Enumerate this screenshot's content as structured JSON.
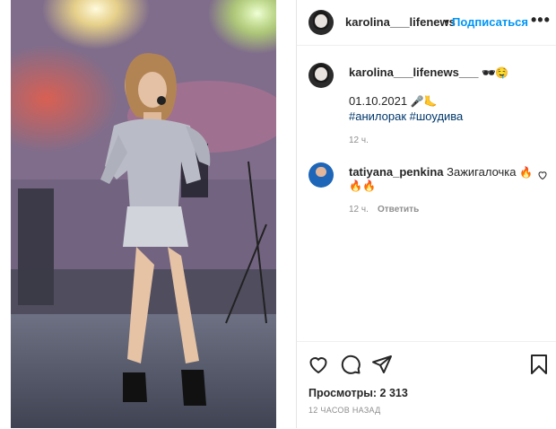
{
  "post": {
    "author": "karolina___lifenews___",
    "author_short": "karolina___lifenews",
    "follow_label": "Подписаться",
    "more_label": "•••",
    "dot": "•"
  },
  "caption": {
    "username": "karolina___lifenews___",
    "emojis_line1": "🕶🤤",
    "date": "01.10.2021",
    "emojis_line2": "🎤🦶",
    "hashtag1": "#анилорак",
    "hashtag2": "#шоудива",
    "time": "12 ч."
  },
  "comment": {
    "username": "tatiyana_penkina",
    "text": "Зажигалочка",
    "emoji_tail": "🔥",
    "emojis_line2": "🔥🔥",
    "time": "12 ч.",
    "reply_label": "Ответить"
  },
  "footer": {
    "views": "Просмотры: 2 313",
    "ago": "12 ЧАСОВ НАЗАД"
  },
  "icons": [
    "heart-icon",
    "comment-icon",
    "share-icon",
    "bookmark-icon"
  ],
  "colors": {
    "link": "#0095f6",
    "hashtag": "#00376b",
    "muted": "#8e8e8e"
  }
}
